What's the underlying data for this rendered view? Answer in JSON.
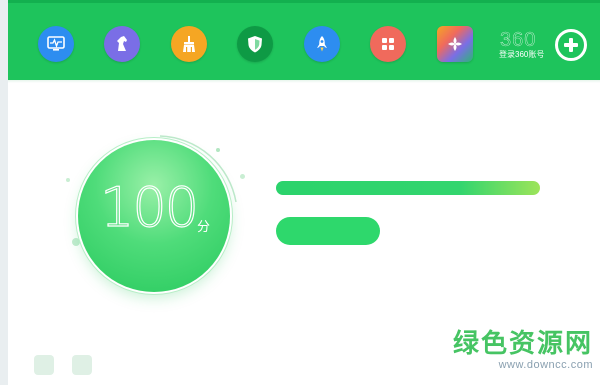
{
  "toolbar": {
    "icons": [
      {
        "name": "computer-checkup-icon",
        "color": "#2d8df0"
      },
      {
        "name": "trojan-horse-icon",
        "color": "#7a6ee6"
      },
      {
        "name": "broom-cleanup-icon",
        "color": "#f5a623"
      },
      {
        "name": "shield-icon",
        "color": "#0e9a45"
      },
      {
        "name": "rocket-speedup-icon",
        "color": "#2d8df0"
      },
      {
        "name": "app-grid-icon",
        "color": "#f06a5c"
      },
      {
        "name": "software-store-icon",
        "color": "#2bb673"
      }
    ],
    "account_logo": "360",
    "account_link": "登录360账号"
  },
  "score": {
    "value": "100",
    "unit": "分"
  },
  "colors": {
    "topbar": "#1ec45c",
    "accent": "#2ed86c",
    "gradient_end": "#9de45a"
  },
  "watermark": {
    "title": "绿色资源网",
    "url": "www.downcc.com"
  }
}
